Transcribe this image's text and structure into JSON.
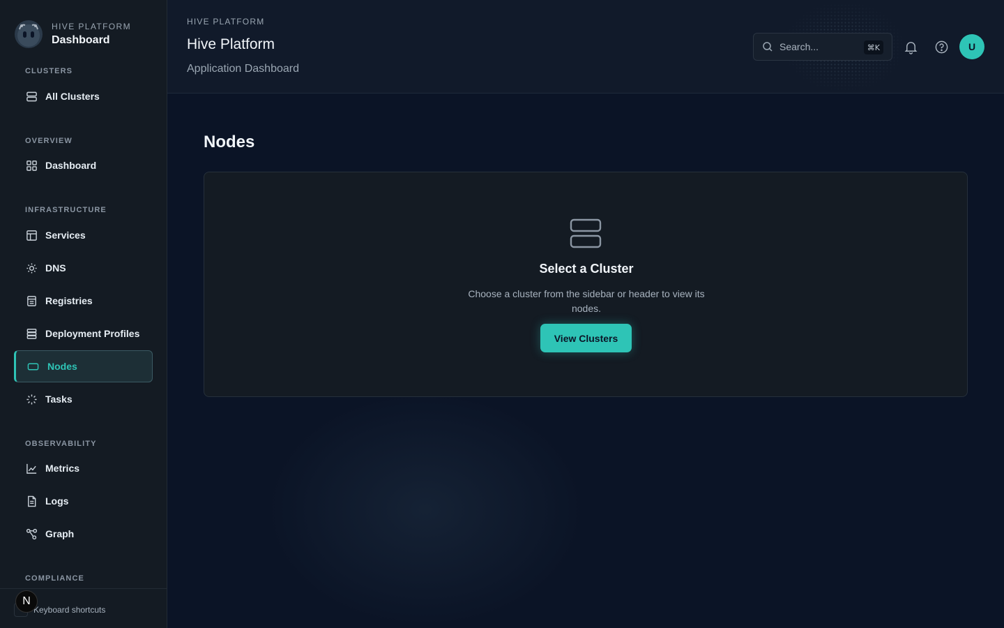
{
  "brand": {
    "sub": "HIVE PLATFORM",
    "title": "Dashboard"
  },
  "sidebar": {
    "sections": {
      "clusters": "CLUSTERS",
      "overview": "OVERVIEW",
      "infrastructure": "INFRASTRUCTURE",
      "observability": "OBSERVABILITY",
      "compliance": "COMPLIANCE"
    },
    "items": {
      "all_clusters": "All Clusters",
      "dashboard": "Dashboard",
      "services": "Services",
      "dns": "DNS",
      "registries": "Registries",
      "deployment_profiles": "Deployment Profiles",
      "nodes": "Nodes",
      "tasks": "Tasks",
      "metrics": "Metrics",
      "logs": "Logs",
      "graph": "Graph"
    },
    "active": "nodes",
    "footer": {
      "shortcuts": "Keyboard shortcuts",
      "badge": "N"
    }
  },
  "header": {
    "eyebrow": "HIVE PLATFORM",
    "title": "Hive Platform",
    "subtitle": "Application Dashboard",
    "search": {
      "placeholder": "Search...",
      "shortcut": "⌘K"
    },
    "avatar": "U"
  },
  "main": {
    "title": "Nodes",
    "empty_state": {
      "title": "Select a Cluster",
      "description": "Choose a cluster from the sidebar or header to view its nodes.",
      "button": "View Clusters"
    }
  },
  "colors": {
    "accent": "#2ec4b6",
    "background": "#0b1426",
    "surface": "#141b23"
  }
}
